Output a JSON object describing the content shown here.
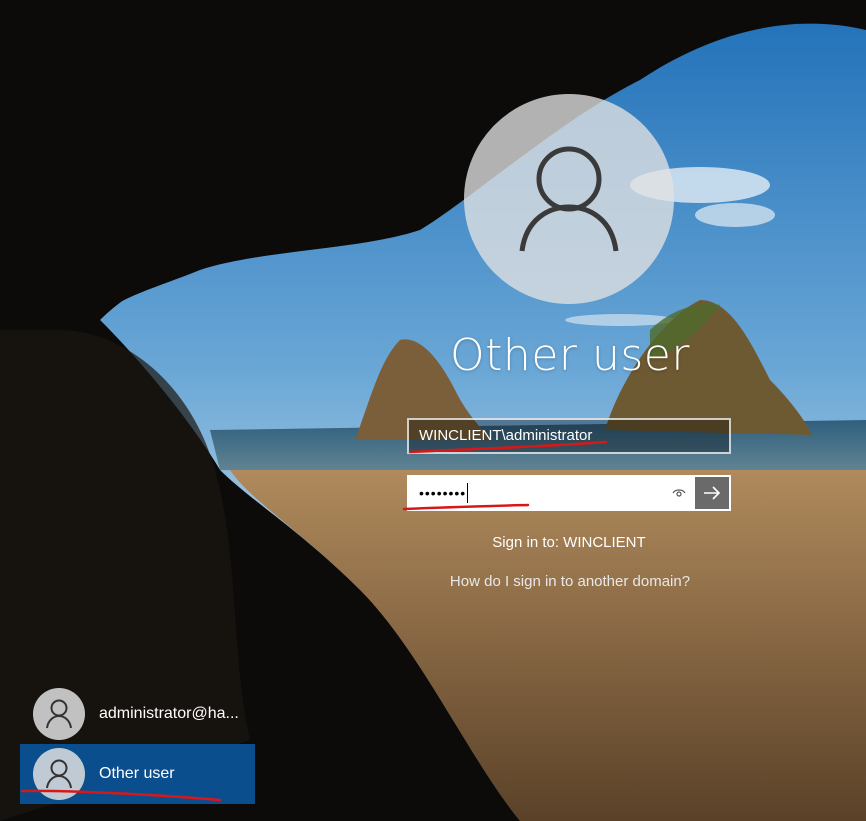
{
  "main": {
    "user_name": "Other user",
    "username_value": "WINCLIENT\\administrator",
    "password_masked": "••••••••",
    "sign_in_to": "Sign in to: WINCLIENT",
    "help_link": "How do I sign in to another domain?"
  },
  "icons": {
    "avatar": "person-icon",
    "reveal": "eye-icon",
    "submit": "arrow-right-icon"
  },
  "users": [
    {
      "label": "administrator@ha..."
    },
    {
      "label": "Other user"
    }
  ],
  "colors": {
    "selected_tile": "#0b4e8e",
    "annotation_underline": "#d81818"
  }
}
